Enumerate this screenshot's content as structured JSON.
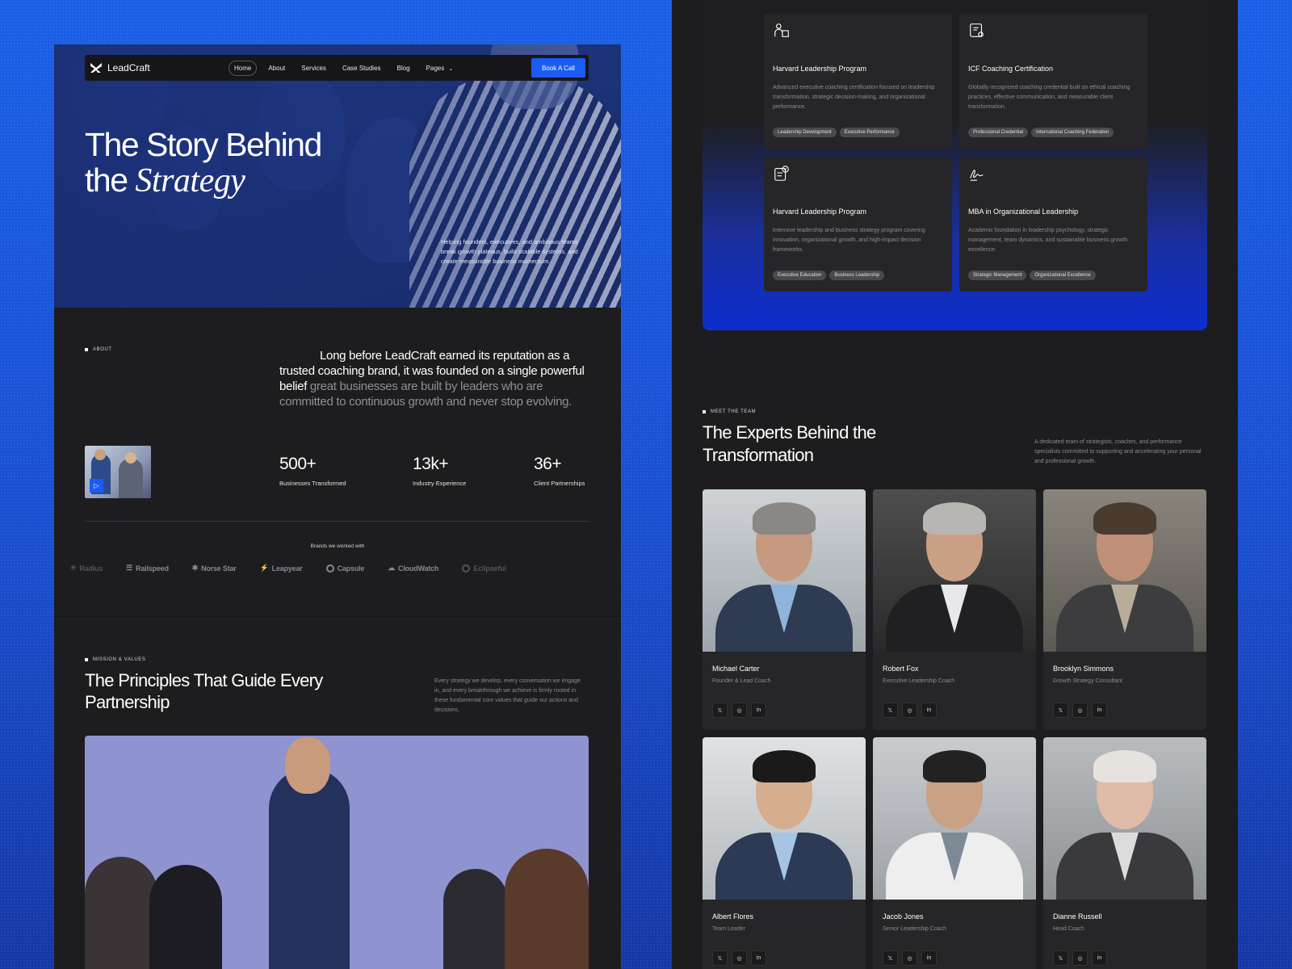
{
  "nav": {
    "logo": "LeadCraft",
    "links": [
      "Home",
      "About",
      "Services",
      "Case Studies",
      "Blog",
      "Pages"
    ],
    "cta": "Book A Call"
  },
  "hero": {
    "title_line1": "The Story Behind",
    "title_line2_plain": "the",
    "title_line2_serif": "Strategy",
    "subtitle": "Helping founders, executives, and ambitious teams break growth plateaus, build scalable systems, and create measurable business momentum."
  },
  "about": {
    "eyebrow": "ABOUT",
    "text_bright": "Long before LeadCraft earned its reputation as a trusted coaching brand, it was founded on a single powerful belief",
    "text_dim": " great businesses are built by leaders who are committed to continuous growth and never stop evolving.",
    "stats": [
      {
        "value": "500+",
        "label": "Businesses Transformed"
      },
      {
        "value": "13k+",
        "label": "Industry Experience"
      },
      {
        "value": "36+",
        "label": "Client Partnerships"
      }
    ],
    "brands_title": "Brands we worked with",
    "brands": [
      "Radius",
      "Railspeed",
      "Norse Star",
      "Leapyear",
      "Capsule",
      "CloudWatch",
      "Eclipseful"
    ]
  },
  "mission": {
    "eyebrow": "MISSION & VALUES",
    "title": "The Principles That Guide Every Partnership",
    "subtitle": "Every strategy we develop, every conversation we engage in, and every breakthrough we achieve is firmly rooted in these fundamental core values that guide our actions and decisions."
  },
  "certifications": [
    {
      "icon": "person-board-icon",
      "title": "Harvard Leadership Program",
      "desc": "Advanced executive coaching certification focused on leadership transformation, strategic decision-making, and organizational performance.",
      "tags": [
        "Leadership Development",
        "Executive Performance"
      ]
    },
    {
      "icon": "certificate-icon",
      "title": "ICF Coaching Certification",
      "desc": "Globally recognized coaching credential built on ethical coaching practices, effective communication, and measurable client transformation.",
      "tags": [
        "Professional Credential",
        "International Coaching Federation"
      ]
    },
    {
      "icon": "document-check-icon",
      "title": "Harvard Leadership Program",
      "desc": "Intensive leadership and business strategy program covering innovation, organizational growth, and high-impact decision frameworks.",
      "tags": [
        "Executive Education",
        "Business Leadership"
      ]
    },
    {
      "icon": "signature-icon",
      "title": "MBA in Organizational Leadership",
      "desc": "Academic foundation in leadership psychology, strategic management, team dynamics, and sustainable business growth excellence.",
      "tags": [
        "Strategic Management",
        "Organizational Excellence"
      ]
    }
  ],
  "team": {
    "eyebrow": "MEET THE TEAM",
    "title": "The Experts Behind the Transformation",
    "subtitle": "A dedicated team of strategists, coaches, and performance specialists committed to supporting and accelerating your personal and professional growth.",
    "members": [
      {
        "name": "Michael Carter",
        "role": "Founder & Lead Coach"
      },
      {
        "name": "Robert Fox",
        "role": "Executive Leadership Coach"
      },
      {
        "name": "Brooklyn Simmons",
        "role": "Growth Strategy Consultant"
      },
      {
        "name": "Albert Flores",
        "role": "Team Leader"
      },
      {
        "name": "Jacob Jones",
        "role": "Senior Leadership Coach"
      },
      {
        "name": "Dianne Russell",
        "role": "Head Coach"
      }
    ],
    "social_icons": [
      "x-icon",
      "instagram-icon",
      "linkedin-icon"
    ]
  },
  "colors": {
    "accent": "#1b5cf5",
    "panel": "#1d1d1f",
    "card": "#262628",
    "background": "#1a4fd0"
  }
}
